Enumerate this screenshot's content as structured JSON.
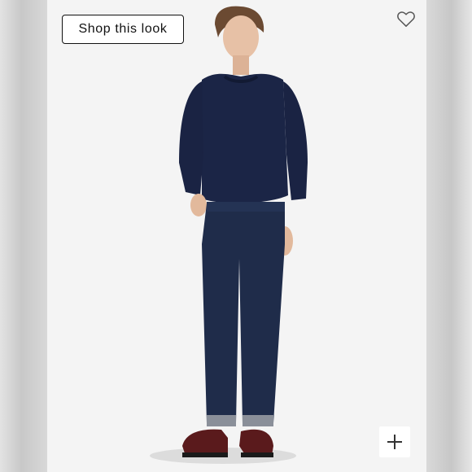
{
  "shop_look": {
    "label": "Shop this look"
  },
  "icons": {
    "favorite": "heart-icon",
    "expand": "plus-icon"
  },
  "colors": {
    "background": "#f4f4f4",
    "sweater": "#1b2546",
    "jeans": "#1f2c4a",
    "shoes": "#5a1a1c",
    "button_border": "#111111"
  }
}
